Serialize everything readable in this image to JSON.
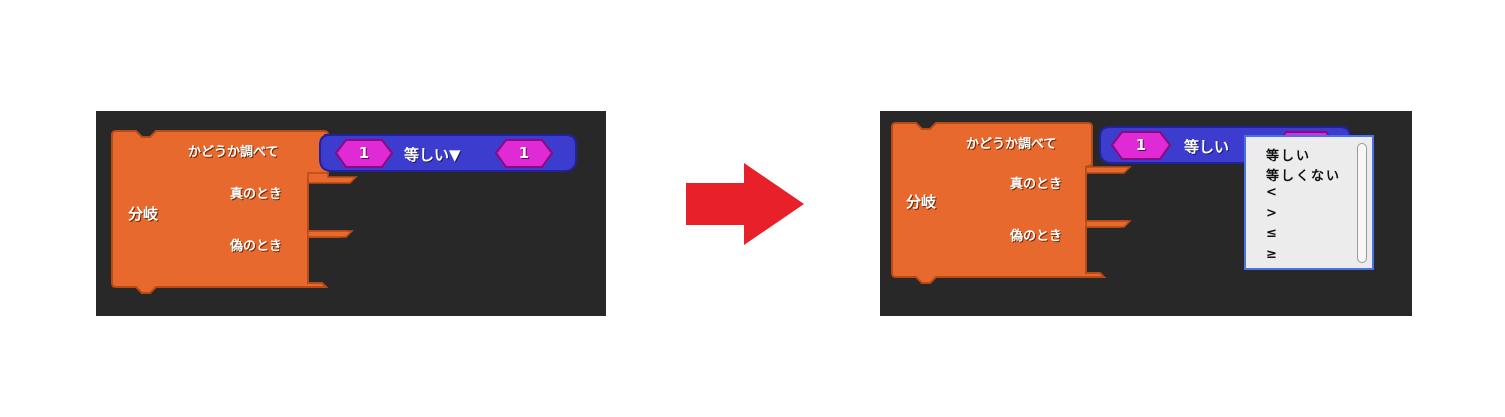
{
  "colors": {
    "block_orange": "#e8692e",
    "block_blue": "#3c3ccf",
    "value_magenta": "#e02ad6",
    "workspace_bg": "#282828",
    "arrow_red": "#e8202a",
    "dropdown_border": "#4a72e6"
  },
  "before": {
    "block": {
      "check_label": "かどうか調べて",
      "name": "分岐",
      "true_label": "真のとき",
      "false_label": "偽のとき"
    },
    "compare": {
      "left_value": "1",
      "operator": "等しい▼",
      "right_value": "1"
    }
  },
  "after": {
    "block": {
      "check_label": "かどうか調べて",
      "name": "分岐",
      "true_label": "真のとき",
      "false_label": "偽のとき"
    },
    "compare": {
      "left_value": "1",
      "operator": "等しい"
    },
    "dropdown": {
      "options": [
        "等しい",
        "等しくない",
        "<",
        ">",
        "≤",
        "≥"
      ]
    }
  },
  "arrow_icon": "right-arrow-icon"
}
